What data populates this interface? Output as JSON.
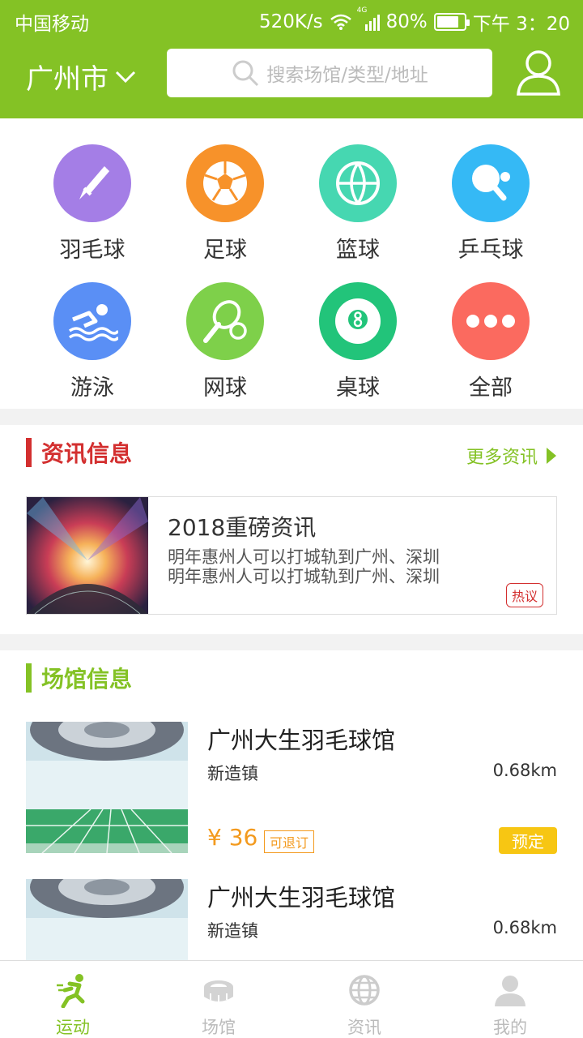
{
  "status": {
    "carrier": "中国移动",
    "speed": "520K/s",
    "network": "4G",
    "battery": "80%",
    "battery_level": 0.8,
    "time": "下午 3：20"
  },
  "header": {
    "city": "广州市",
    "search_placeholder": "搜索场馆/类型/地址"
  },
  "categories": [
    {
      "label": "羽毛球",
      "icon": "shuttlecock-icon",
      "color": "#a47ee6"
    },
    {
      "label": "足球",
      "icon": "soccer-ball-icon",
      "color": "#f7922a"
    },
    {
      "label": "篮球",
      "icon": "basketball-icon",
      "color": "#46d7b1"
    },
    {
      "label": "乒乓球",
      "icon": "ping-pong-icon",
      "color": "#35b9f5"
    },
    {
      "label": "游泳",
      "icon": "swimming-icon",
      "color": "#5a8ff5"
    },
    {
      "label": "网球",
      "icon": "tennis-icon",
      "color": "#7ed04a"
    },
    {
      "label": "桌球",
      "icon": "billiards-icon",
      "color": "#22c47a"
    },
    {
      "label": "全部",
      "icon": "more-dots-icon",
      "color": "#fb6a5f"
    }
  ],
  "news": {
    "title": "资讯信息",
    "more": "更多资讯",
    "card": {
      "title": "2018重磅资讯",
      "line1": "明年惠州人可以打城轨到广州、深圳",
      "line2": "明年惠州人可以打城轨到广州、深圳",
      "tag": "热议"
    }
  },
  "venues": {
    "title": "场馆信息",
    "items": [
      {
        "name": "广州大生羽毛球馆",
        "area": "新造镇",
        "distance": "0.68km",
        "price": "¥ 36",
        "refund": "可退订",
        "book": "预定"
      },
      {
        "name": "广州大生羽毛球馆",
        "area": "新造镇",
        "distance": "0.68km"
      }
    ]
  },
  "tabs": [
    {
      "label": "运动",
      "icon": "running-icon",
      "active": true
    },
    {
      "label": "场馆",
      "icon": "stadium-icon",
      "active": false
    },
    {
      "label": "资讯",
      "icon": "globe-icon",
      "active": false
    },
    {
      "label": "我的",
      "icon": "profile-icon",
      "active": false
    }
  ],
  "colors": {
    "brand": "#84c225",
    "news_accent": "#d32f2f",
    "price": "#f39a1e",
    "book": "#f7c613"
  }
}
